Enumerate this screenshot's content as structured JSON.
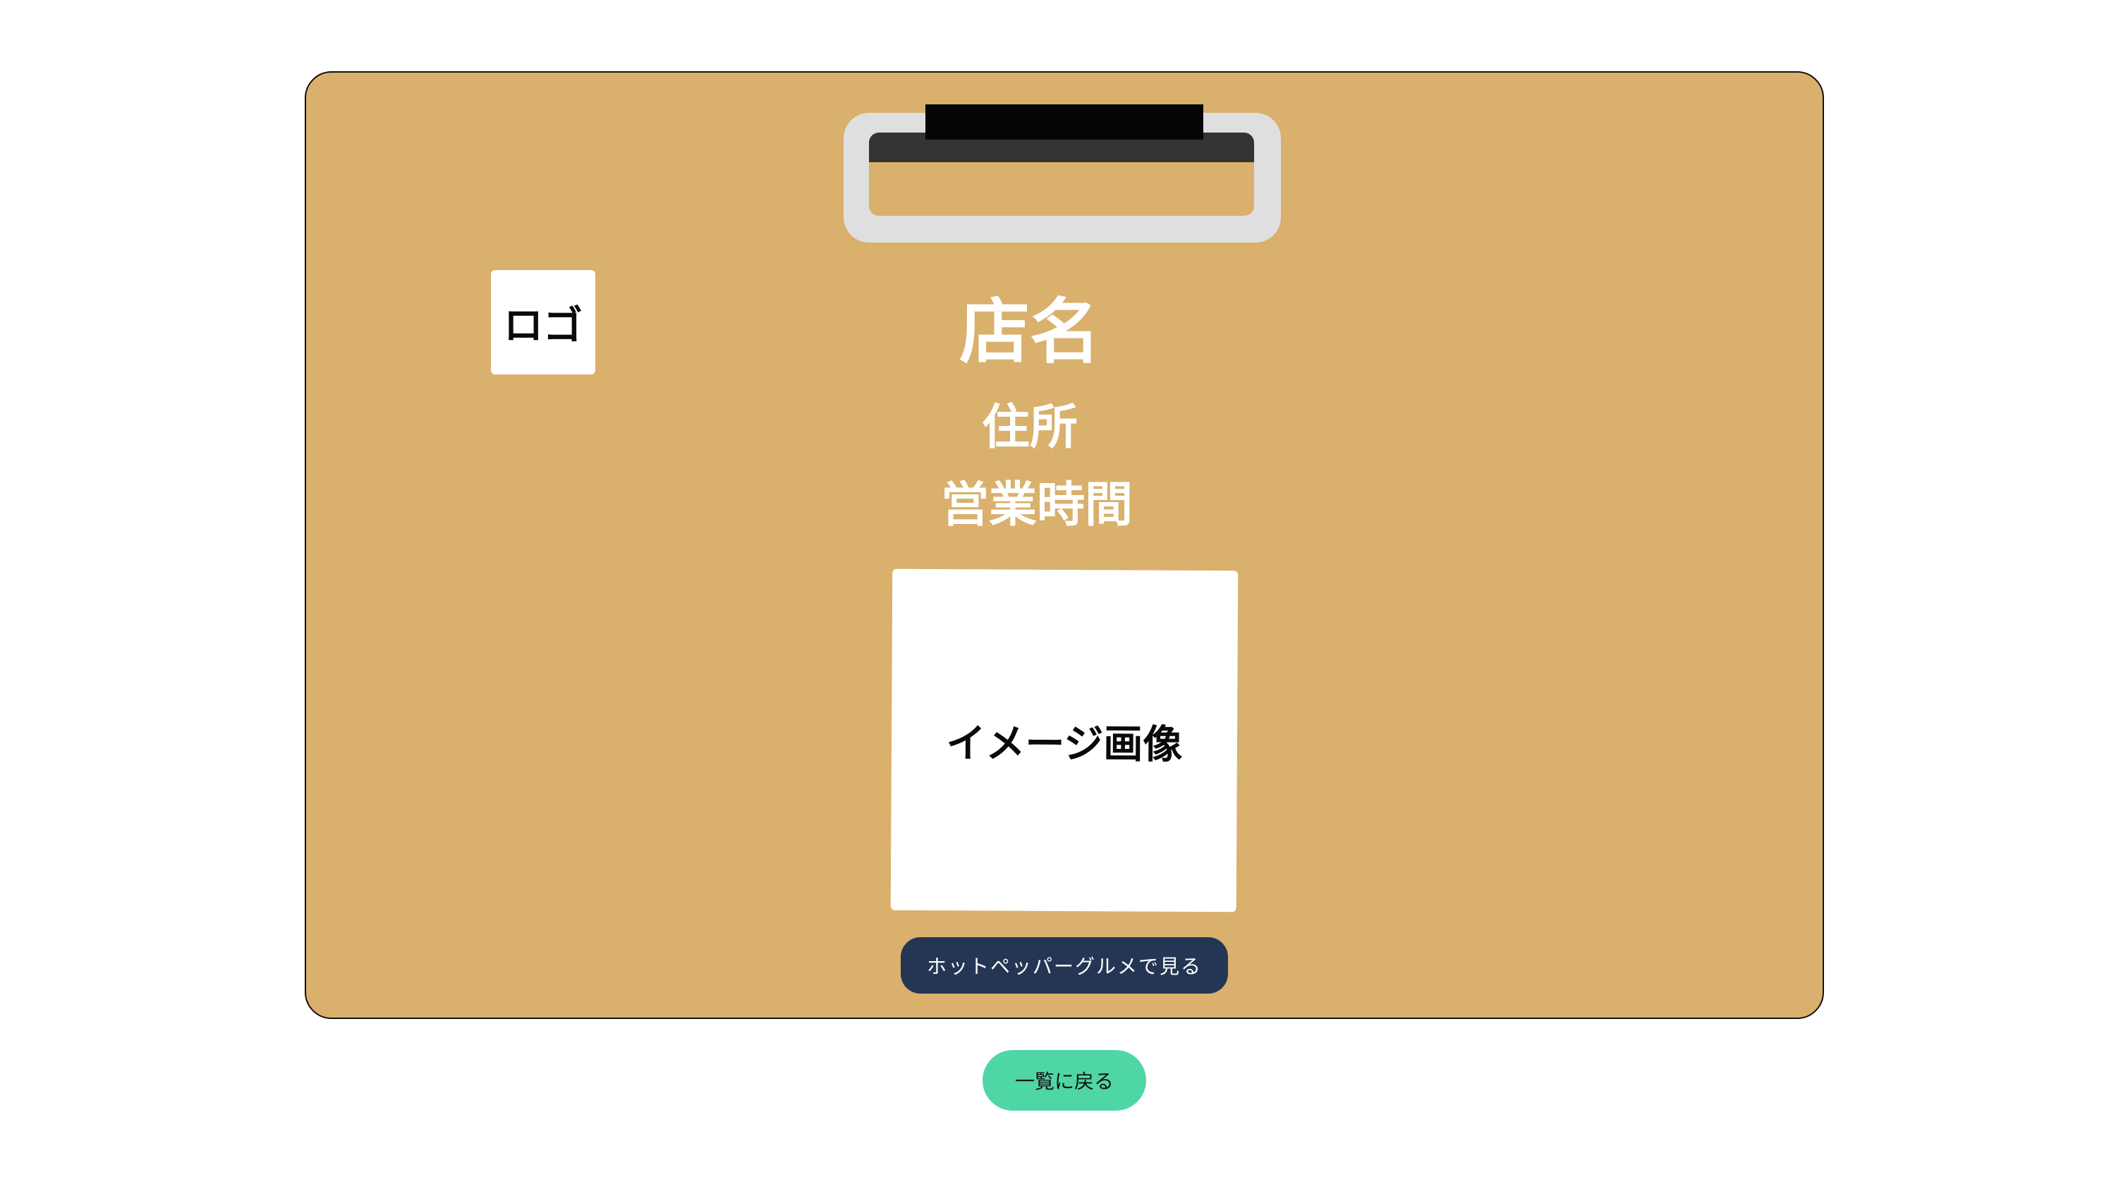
{
  "card": {
    "logo_label": "ロゴ",
    "shop_name": "店名",
    "address": "住所",
    "hours": "営業時間",
    "image_label": "イメージ画像",
    "hotpepper_button_label": "ホットペッパーグルメで見る"
  },
  "nav": {
    "back_label": "一覧に戻る"
  },
  "colors": {
    "board": "#d9b06c",
    "clip_frame": "#e0dfdf",
    "clip_dark": "#333333",
    "hotpepper_button": "#243653",
    "back_button": "#4fd6a5"
  },
  "icons": {
    "clip": "clipboard-clip-icon"
  }
}
